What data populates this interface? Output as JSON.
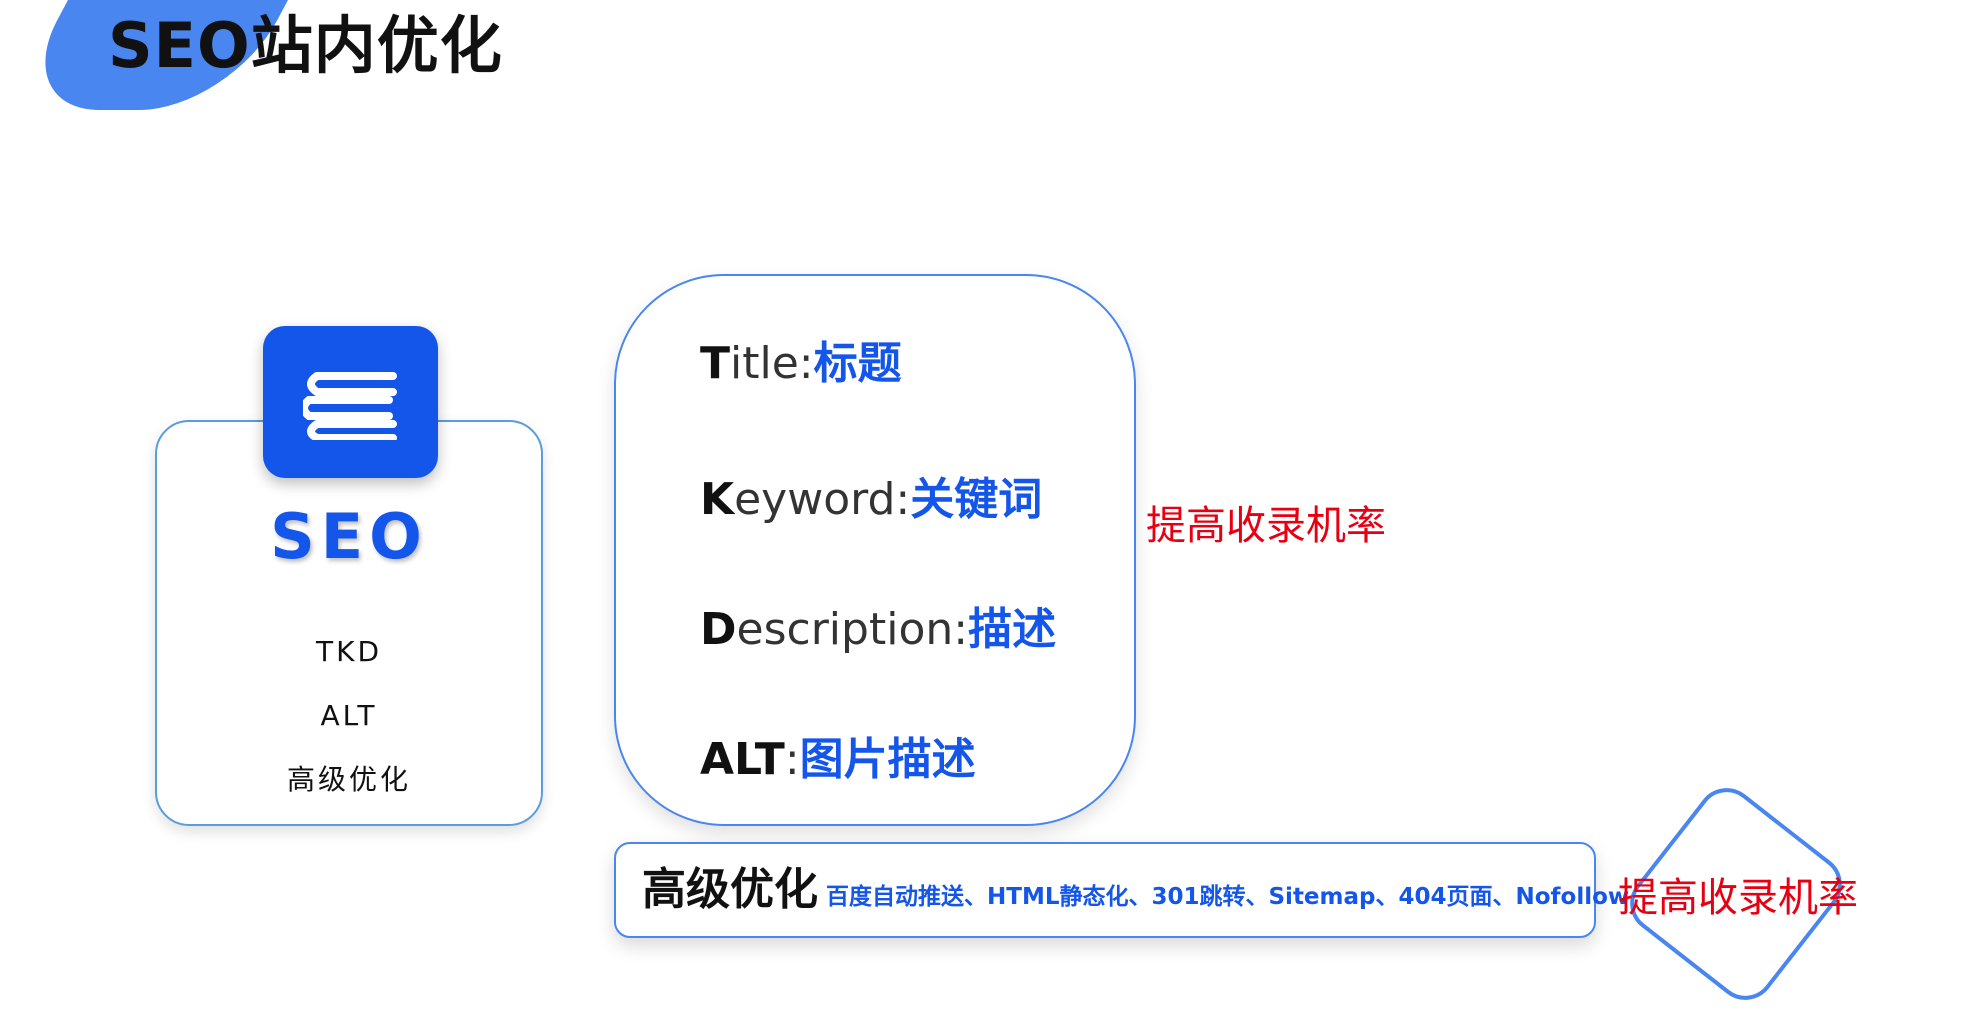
{
  "page": {
    "title": "SEO站内优化"
  },
  "seo_card": {
    "heading": "SEO",
    "icon": "stacked-books-icon",
    "items": [
      "TKD",
      "ALT",
      "高级优化"
    ]
  },
  "tkd_card": {
    "rows": [
      {
        "lead": "T",
        "rest": "itle:",
        "zh": "标题"
      },
      {
        "lead": "K",
        "rest": "eyword:",
        "zh": "关键词"
      },
      {
        "lead": "D",
        "rest": "escription:",
        "zh": "描述"
      },
      {
        "lead": "ALT",
        "rest": ":",
        "zh": "图片描述"
      }
    ]
  },
  "side_note_1": "提高收录机率",
  "advanced": {
    "title": "高级优化",
    "detail": "百度自动推送、HTML静态化、301跳转、Sitemap、404页面、Nofollow"
  },
  "side_note_2": "提高收录机率",
  "colors": {
    "accent": "#1556ea",
    "outline": "#4a86f0",
    "emphasis": "#e60012"
  }
}
